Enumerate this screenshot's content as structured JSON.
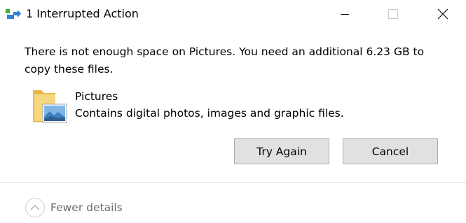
{
  "window": {
    "title": "1 Interrupted Action",
    "icon": "copy-transfer-icon",
    "controls": {
      "minimize": "minimize-icon",
      "maximize": "maximize-icon",
      "close": "close-icon"
    }
  },
  "message": "There is not enough space on Pictures. You need an additional 6.23 GB to copy these files.",
  "location": {
    "name": "Pictures",
    "description": "Contains digital photos, images and graphic files.",
    "icon": "pictures-folder-icon"
  },
  "buttons": {
    "try_again": "Try Again",
    "cancel": "Cancel"
  },
  "footer": {
    "details_label": "Fewer details",
    "details_icon": "chevron-up-circle-icon"
  }
}
